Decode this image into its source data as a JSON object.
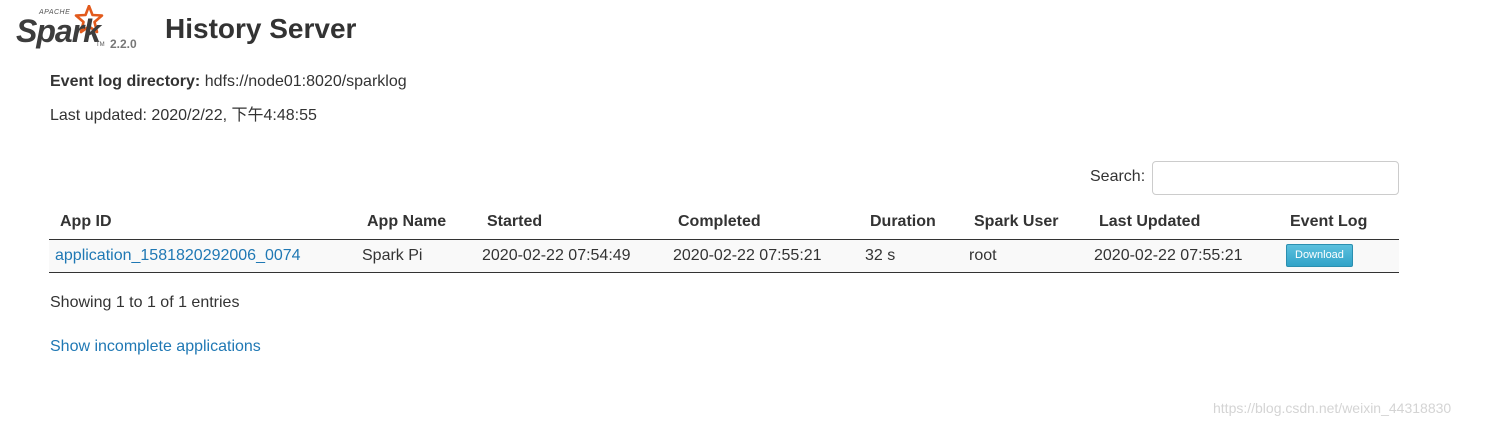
{
  "brand": {
    "apache_label": "APACHE",
    "spark_label": "Spark",
    "trademark": "TM",
    "version": "2.2.0"
  },
  "header": {
    "title": "History Server"
  },
  "info": {
    "event_log_label": "Event log directory:",
    "event_log_value": "hdfs://node01:8020/sparklog",
    "last_updated": "Last updated: 2020/2/22, 下午4:48:55"
  },
  "search": {
    "label": "Search:",
    "value": "",
    "placeholder": ""
  },
  "table": {
    "columns": [
      "App ID",
      "App Name",
      "Started",
      "Completed",
      "Duration",
      "Spark User",
      "Last Updated",
      "Event Log"
    ],
    "rows": [
      {
        "app_id": "application_1581820292006_0074",
        "app_name": "Spark Pi",
        "started": "2020-02-22 07:54:49",
        "completed": "2020-02-22 07:55:21",
        "duration": "32 s",
        "spark_user": "root",
        "last_updated": "2020-02-22 07:55:21",
        "event_log_button": "Download"
      }
    ]
  },
  "footer": {
    "entries_info": "Showing 1 to 1 of 1 entries",
    "show_incomplete": "Show incomplete applications",
    "watermark": "https://blog.csdn.net/weixin_44318830"
  },
  "colors": {
    "link": "#1f78b4",
    "logo_orange": "#e25a1c",
    "button": "#5bc0de",
    "row_bg": "#f9f9f9"
  }
}
